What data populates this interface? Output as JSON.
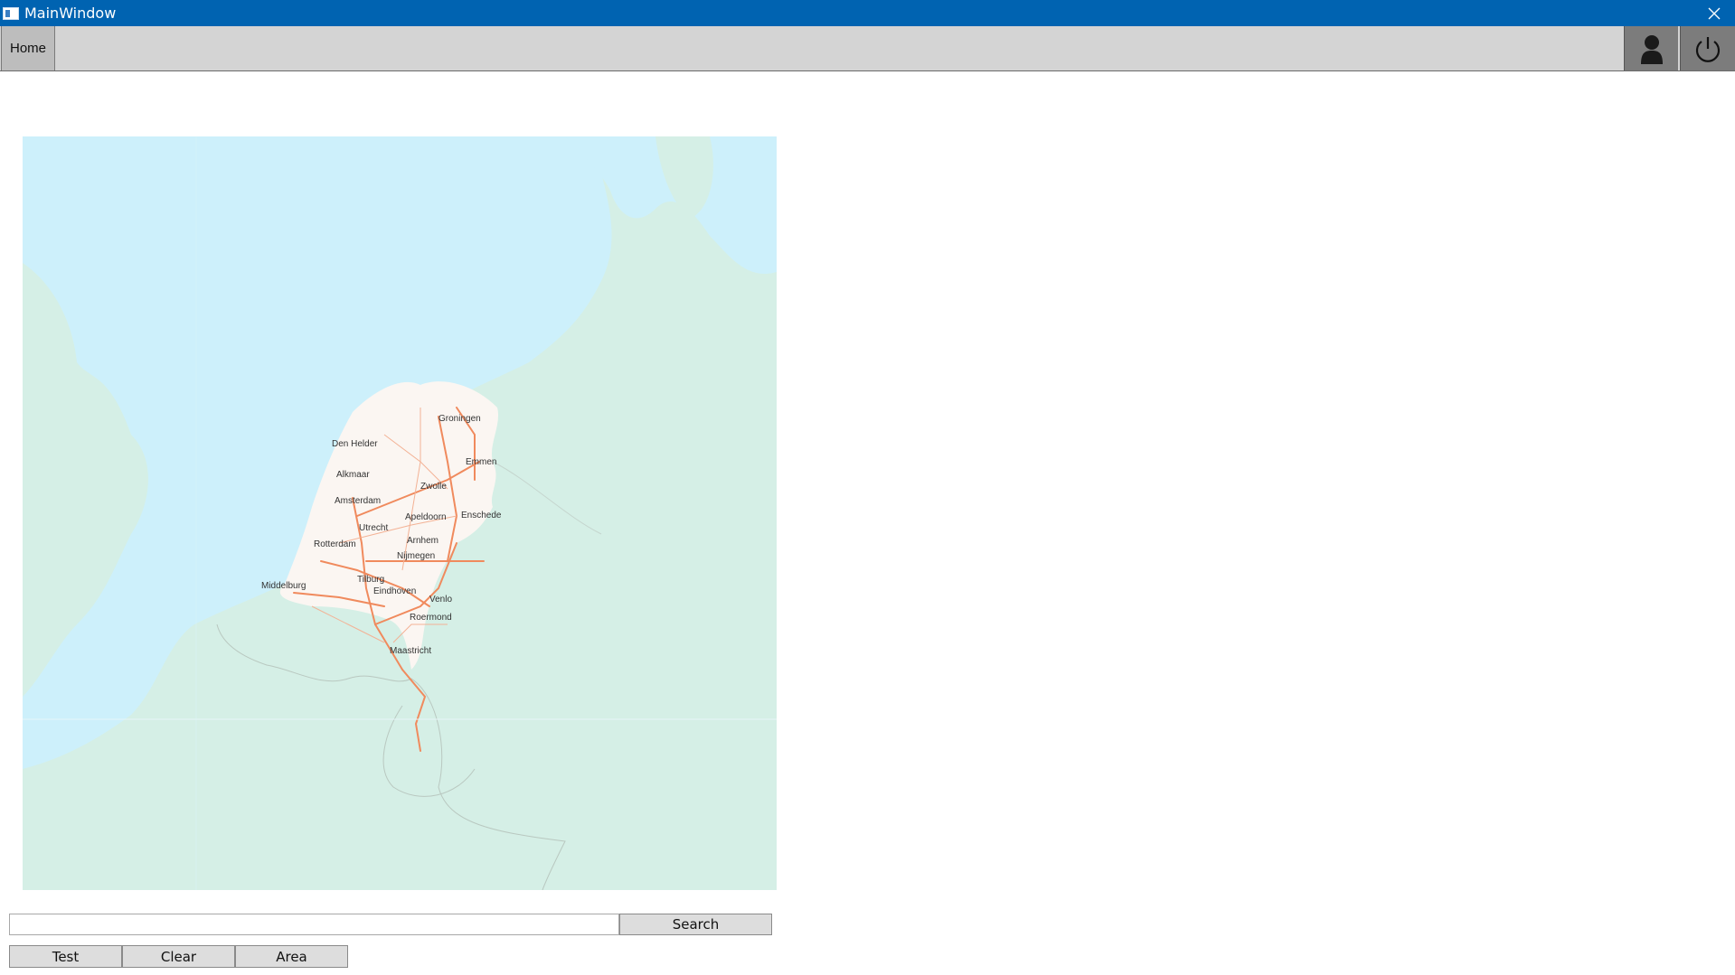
{
  "window": {
    "title": "MainWindow"
  },
  "toolbar": {
    "home_label": "Home"
  },
  "map": {
    "cities": [
      "Groningen",
      "Den Helder",
      "Emmen",
      "Alkmaar",
      "Zwolle",
      "Amsterdam",
      "Apeldoorn",
      "Enschede",
      "Utrecht",
      "Arnhem",
      "Rotterdam",
      "Nijmegen",
      "Middelburg",
      "Tilburg",
      "Eindhoven",
      "Venlo",
      "Roermond",
      "Maastricht"
    ],
    "colors": {
      "sea": "#cdf0fb",
      "land": "#d5efe6",
      "netherlands": "#fbf6f2",
      "roads": "#f08a5d",
      "borders": "#b9c8c0"
    }
  },
  "search": {
    "placeholder": "",
    "button_label": "Search"
  },
  "actions": {
    "test_label": "Test",
    "clear_label": "Clear",
    "area_label": "Area"
  },
  "icons": {
    "close": "close-icon",
    "user": "user-icon",
    "power": "power-icon"
  }
}
